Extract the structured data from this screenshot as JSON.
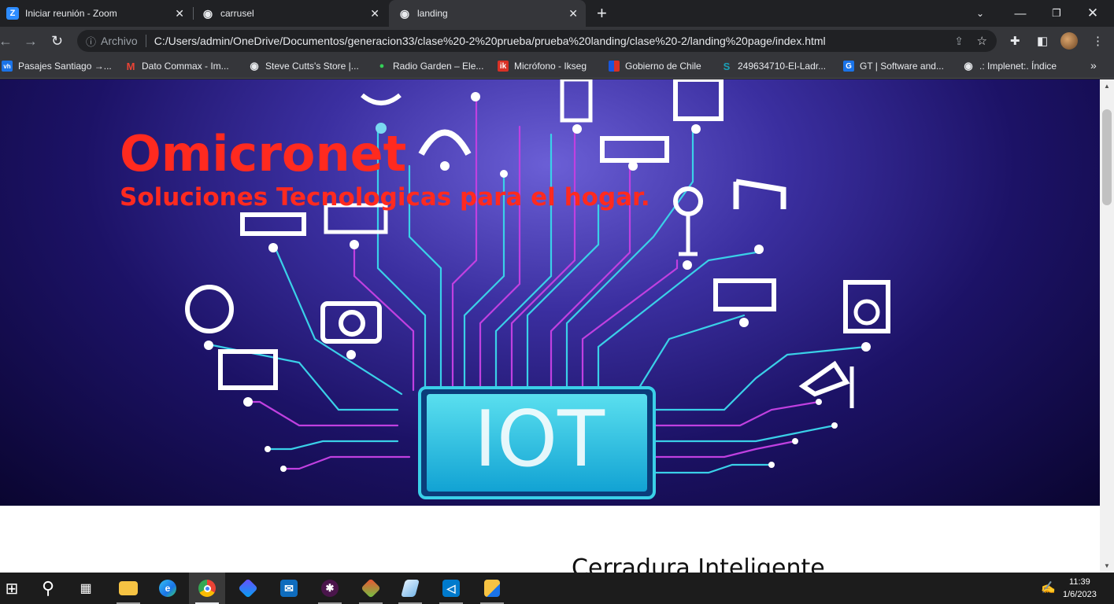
{
  "browser": {
    "tabs": [
      {
        "title": "Iniciar reunión - Zoom",
        "favicon": "zoom-icon",
        "active": false
      },
      {
        "title": "carrusel",
        "favicon": "globe-icon",
        "active": false
      },
      {
        "title": "landing",
        "favicon": "globe-icon",
        "active": true
      }
    ],
    "address": {
      "info_label": "Archivo",
      "url": "C:/Users/admin/OneDrive/Documentos/generacion33/clase%20-2%20prueba/prueba%20landing/clase%20-2/landing%20page/index.html"
    },
    "bookmarks": [
      {
        "label": "Pasajes Santiago →...",
        "icon": "vh-icon",
        "color": "#1a73e8",
        "glyph": "vh"
      },
      {
        "label": "Dato Commax - Im...",
        "icon": "gmail-icon",
        "color": "#ea4335",
        "glyph": "M"
      },
      {
        "label": "Steve Cutts's Store |...",
        "icon": "globe-icon",
        "color": "#e8eaed",
        "glyph": "◉"
      },
      {
        "label": "Radio Garden – Ele...",
        "icon": "radio-garden-icon",
        "color": "#34d058",
        "glyph": "●"
      },
      {
        "label": "Micrófono - Ikseg",
        "icon": "ikseg-icon",
        "color": "#d93025",
        "glyph": "ik"
      },
      {
        "label": "Gobierno de Chile",
        "icon": "gobierno-icon",
        "color": "#1a56db",
        "glyph": ""
      },
      {
        "label": "249634710-El-Ladr...",
        "icon": "scribd-icon",
        "color": "#1aa0b8",
        "glyph": "S"
      },
      {
        "label": "GT | Software and...",
        "icon": "gt-icon",
        "color": "#1a73e8",
        "glyph": "G"
      },
      {
        "label": ".: Implenet:. Índice",
        "icon": "globe-icon",
        "color": "#e8eaed",
        "glyph": "◉"
      }
    ],
    "bookmarks_overflow": "»"
  },
  "page": {
    "brand": "Omicronet",
    "tagline": "Soluciones Tecnologicas para el hogar.",
    "hero_chip_text": "IOT",
    "section_title": "Cerradura Inteligente"
  },
  "taskbar": {
    "time": "11:39",
    "date": "1/6/2023",
    "apps": [
      {
        "name": "start-button",
        "glyph": "⊞"
      },
      {
        "name": "search-icon",
        "glyph": "⚲"
      },
      {
        "name": "task-view-icon",
        "glyph": "▦"
      },
      {
        "name": "file-explorer-icon",
        "glyph": "▬"
      },
      {
        "name": "edge-icon",
        "glyph": "e"
      },
      {
        "name": "chrome-icon",
        "glyph": "●"
      },
      {
        "name": "app-icon",
        "glyph": "◆"
      },
      {
        "name": "mail-icon",
        "glyph": "✉"
      },
      {
        "name": "slack-icon",
        "glyph": "✱"
      },
      {
        "name": "git-icon",
        "glyph": "◈"
      },
      {
        "name": "notes-icon",
        "glyph": "◧"
      },
      {
        "name": "vscode-icon",
        "glyph": "◁"
      },
      {
        "name": "folder-icon",
        "glyph": "▮"
      }
    ]
  },
  "colors": {
    "accent_red": "#ff2a1f",
    "hero_dark": "#0a0530",
    "hero_light": "#6b5fd6",
    "circuit_cyan": "#3ad0e8",
    "circuit_magenta": "#c040e0"
  }
}
